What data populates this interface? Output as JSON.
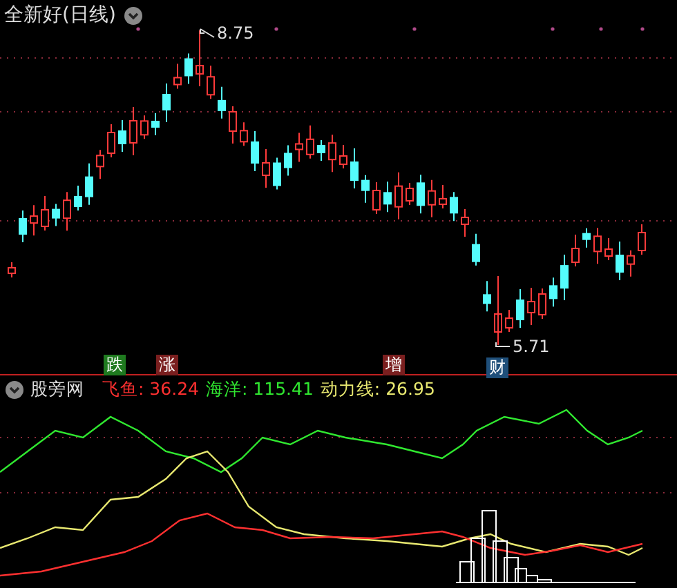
{
  "main_chart": {
    "title": "全新好(日线)",
    "price_labels": [
      {
        "kind": "high",
        "text": "8.75"
      },
      {
        "kind": "low",
        "text": "5.71"
      }
    ],
    "markers": [
      {
        "text": "跌",
        "color": "#1f7a1f"
      },
      {
        "text": "涨",
        "color": "#7a1f1f"
      },
      {
        "text": "增",
        "color": "#7a1f1f"
      },
      {
        "text": "财",
        "color": "#1f4f7a"
      }
    ]
  },
  "indicator": {
    "name": "股旁网",
    "series": [
      {
        "name": "飞鱼:",
        "value": "36.24",
        "color": "#ff3030"
      },
      {
        "name": "海洋:",
        "value": "115.41",
        "color": "#30e830"
      },
      {
        "name": "动力线:",
        "value": "26.95",
        "color": "#e8e870"
      }
    ]
  }
}
